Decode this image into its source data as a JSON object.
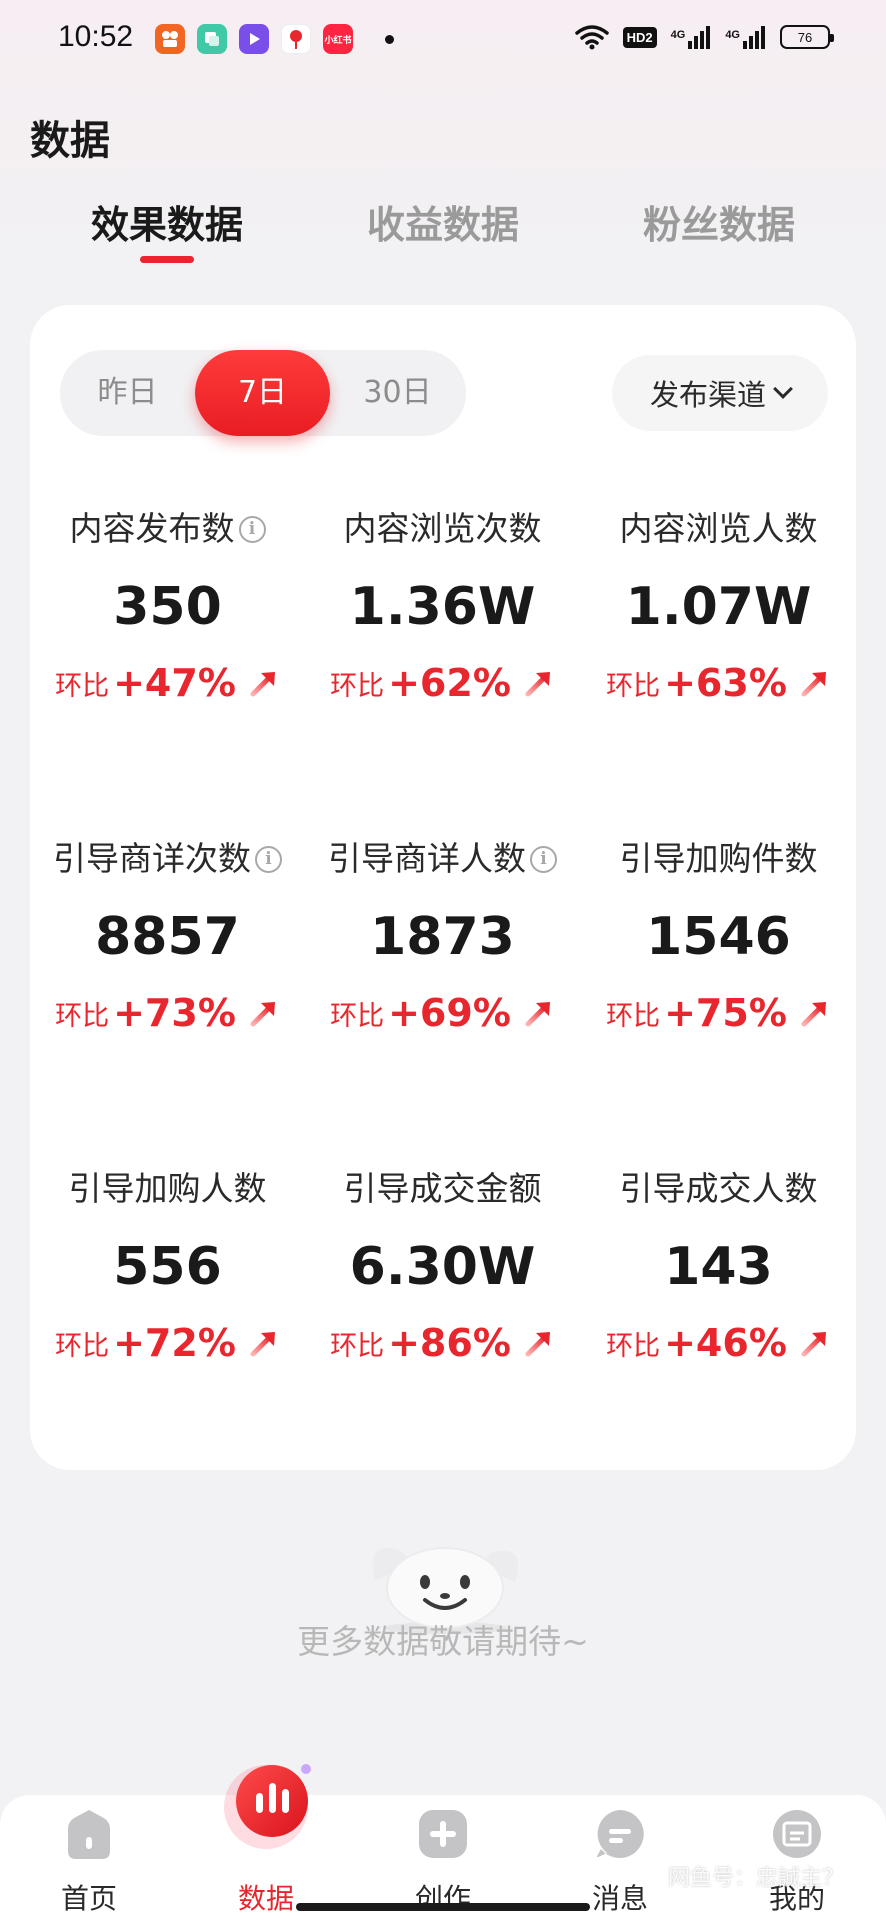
{
  "status_bar": {
    "time": "10:52",
    "hd_label": "HD2",
    "network_1": "4G",
    "network_2": "4G",
    "battery": "76",
    "app_icons": [
      "kuaishou-icon",
      "clone-app-icon",
      "video-player-icon",
      "dewu-icon",
      "xiaohongshu-icon"
    ],
    "xiaohongshu_text": "小红书"
  },
  "page": {
    "title": "数据"
  },
  "tabs": [
    {
      "label": "效果数据",
      "active": true
    },
    {
      "label": "收益数据",
      "active": false
    },
    {
      "label": "粉丝数据",
      "active": false
    }
  ],
  "period_selector": [
    {
      "label": "昨日",
      "active": false
    },
    {
      "label": "7日",
      "active": true
    },
    {
      "label": "30日",
      "active": false
    }
  ],
  "channel_filter": {
    "label": "发布渠道"
  },
  "metrics": [
    {
      "label": "内容发布数",
      "value": "350",
      "change_prefix": "环比",
      "change": "+47%",
      "info": true
    },
    {
      "label": "内容浏览次数",
      "value": "1.36W",
      "change_prefix": "环比",
      "change": "+62%",
      "info": false
    },
    {
      "label": "内容浏览人数",
      "value": "1.07W",
      "change_prefix": "环比",
      "change": "+63%",
      "info": false
    },
    {
      "label": "引导商详次数",
      "value": "8857",
      "change_prefix": "环比",
      "change": "+73%",
      "info": true
    },
    {
      "label": "引导商详人数",
      "value": "1873",
      "change_prefix": "环比",
      "change": "+69%",
      "info": true
    },
    {
      "label": "引导加购件数",
      "value": "1546",
      "change_prefix": "环比",
      "change": "+75%",
      "info": false
    },
    {
      "label": "引导加购人数",
      "value": "556",
      "change_prefix": "环比",
      "change": "+72%",
      "info": false
    },
    {
      "label": "引导成交金额",
      "value": "6.30W",
      "change_prefix": "环比",
      "change": "+86%",
      "info": false
    },
    {
      "label": "引导成交人数",
      "value": "143",
      "change_prefix": "环比",
      "change": "+46%",
      "info": false
    }
  ],
  "empty_state": {
    "text": "更多数据敬请期待~"
  },
  "bottom_nav": [
    {
      "label": "首页",
      "icon": "home-icon",
      "active": false
    },
    {
      "label": "数据",
      "icon": "bar-chart-icon",
      "active": true
    },
    {
      "label": "创作",
      "icon": "plus-icon",
      "active": false
    },
    {
      "label": "消息",
      "icon": "message-icon",
      "active": false
    },
    {
      "label": "我的",
      "icon": "profile-icon",
      "active": false
    }
  ],
  "watermark": "网鱼号：忠誠主？",
  "colors": {
    "accent": "#e8262d",
    "background": "#f2f2f4",
    "card": "#ffffff"
  }
}
